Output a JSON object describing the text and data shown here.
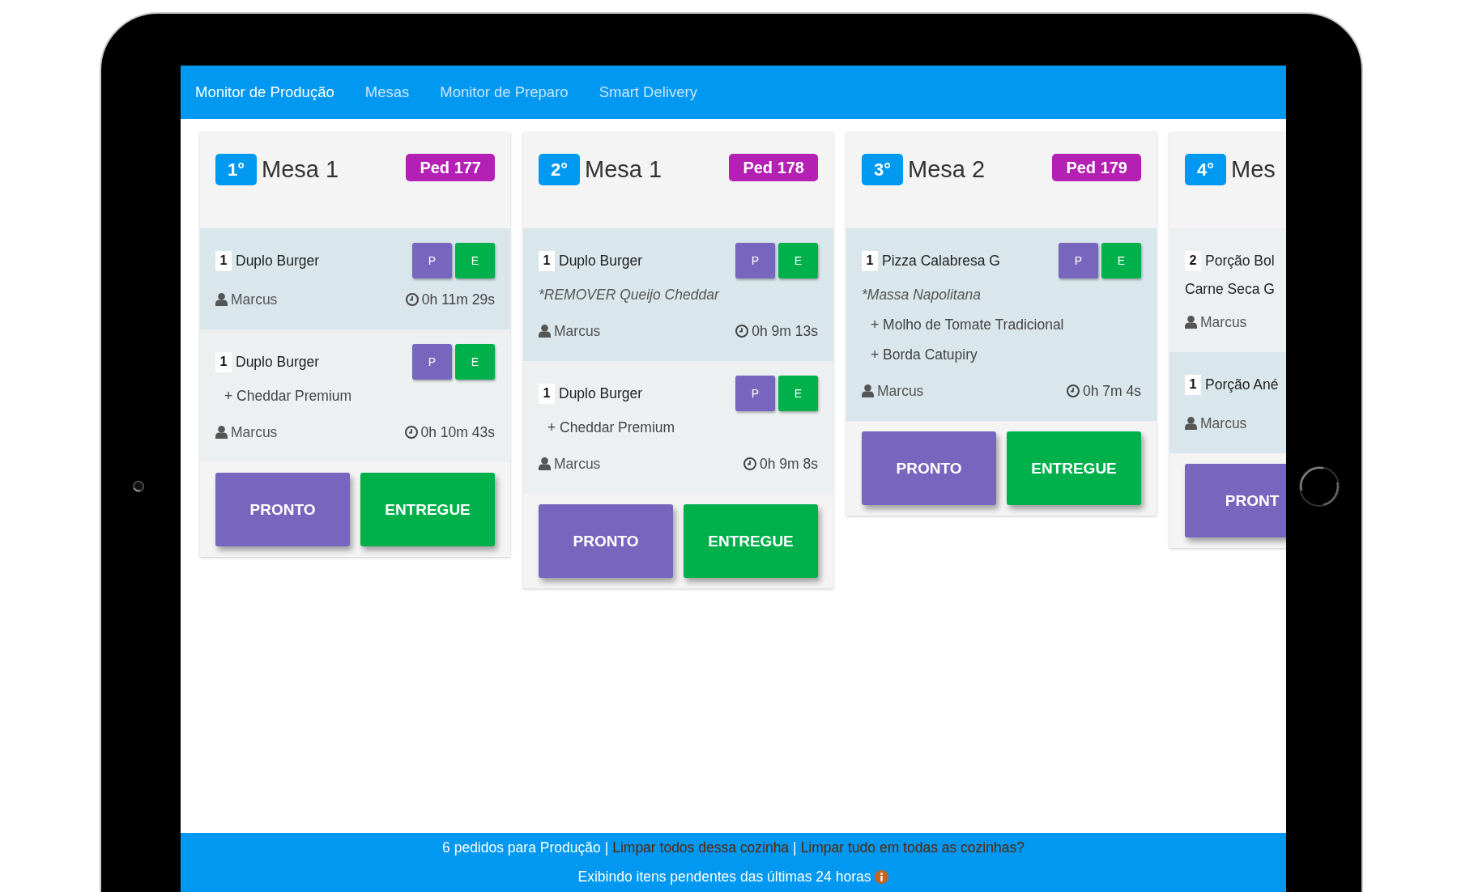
{
  "nav": {
    "items": [
      {
        "label": "Monitor de Produção",
        "selected": true
      },
      {
        "label": "Mesas",
        "selected": false
      },
      {
        "label": "Monitor de Preparo",
        "selected": false
      },
      {
        "label": "Smart Delivery",
        "selected": false
      }
    ]
  },
  "orders": [
    {
      "rank": "1°",
      "title": "Mesa 1",
      "order_badge": "Ped 177",
      "items": [
        {
          "qty": "1",
          "name": "Duplo Burger",
          "highlighted": true,
          "actions": [
            {
              "label": "P",
              "kind": "ready"
            },
            {
              "label": "E",
              "kind": "delivered"
            }
          ],
          "waiter": "Marcus",
          "elapsed": "0h 11m 29s"
        },
        {
          "qty": "1",
          "name": "Duplo Burger",
          "highlighted": false,
          "actions": [
            {
              "label": "P",
              "kind": "ready"
            },
            {
              "label": "E",
              "kind": "delivered"
            }
          ],
          "lines": [
            {
              "kind": "addon",
              "text": "+ Cheddar Premium"
            }
          ],
          "waiter": "Marcus",
          "elapsed": "0h 10m 43s"
        }
      ],
      "buttons": [
        {
          "label": "PRONTO",
          "kind": "ready"
        },
        {
          "label": "ENTREGUE",
          "kind": "delivered"
        }
      ]
    },
    {
      "rank": "2°",
      "title": "Mesa 1",
      "order_badge": "Ped 178",
      "items": [
        {
          "qty": "1",
          "name": "Duplo Burger",
          "highlighted": true,
          "actions": [
            {
              "label": "P",
              "kind": "ready"
            },
            {
              "label": "E",
              "kind": "delivered"
            }
          ],
          "lines": [
            {
              "kind": "note",
              "text": "*REMOVER Queijo Cheddar"
            }
          ],
          "waiter": "Marcus",
          "elapsed": "0h 9m 13s"
        },
        {
          "qty": "1",
          "name": "Duplo Burger",
          "highlighted": false,
          "actions": [
            {
              "label": "P",
              "kind": "ready"
            },
            {
              "label": "E",
              "kind": "delivered"
            }
          ],
          "lines": [
            {
              "kind": "addon",
              "text": "+ Cheddar Premium"
            }
          ],
          "waiter": "Marcus",
          "elapsed": "0h 9m 8s"
        }
      ],
      "buttons": [
        {
          "label": "PRONTO",
          "kind": "ready"
        },
        {
          "label": "ENTREGUE",
          "kind": "delivered"
        }
      ]
    },
    {
      "rank": "3°",
      "title": "Mesa 2",
      "order_badge": "Ped 179",
      "items": [
        {
          "qty": "1",
          "name": "Pizza Calabresa G",
          "highlighted": true,
          "actions": [
            {
              "label": "P",
              "kind": "ready"
            },
            {
              "label": "E",
              "kind": "delivered"
            }
          ],
          "lines": [
            {
              "kind": "note",
              "text": "*Massa Napolitana"
            },
            {
              "kind": "addon",
              "text": "+ Molho de Tomate Tradicional"
            },
            {
              "kind": "addon",
              "text": "+ Borda Catupiry"
            }
          ],
          "waiter": "Marcus",
          "elapsed": "0h 7m 4s"
        }
      ],
      "buttons": [
        {
          "label": "PRONTO",
          "kind": "ready"
        },
        {
          "label": "ENTREGUE",
          "kind": "delivered"
        }
      ]
    },
    {
      "rank": "4°",
      "title": "Mes",
      "items": [
        {
          "qty": "2",
          "name": "Porção Bol",
          "name_continued": "Carne Seca G",
          "highlighted": false,
          "waiter": "Marcus"
        },
        {
          "qty": "1",
          "name": "Porção Ané",
          "highlighted": true,
          "waiter": "Marcus"
        }
      ],
      "buttons": [
        {
          "label": "PRONT",
          "kind": "ready"
        }
      ]
    }
  ],
  "footer": {
    "segments": [
      {
        "kind": "text",
        "text": "6 pedidos para Produção"
      },
      {
        "kind": "separator",
        "text": "|"
      },
      {
        "kind": "link",
        "text": "Limpar todos dessa cozinha"
      },
      {
        "kind": "separator",
        "text": "|"
      },
      {
        "kind": "link",
        "text": "Limpar tudo em todas as cozinhas?"
      }
    ],
    "note": "Exibindo itens pendentes das últimas 24 horas"
  }
}
